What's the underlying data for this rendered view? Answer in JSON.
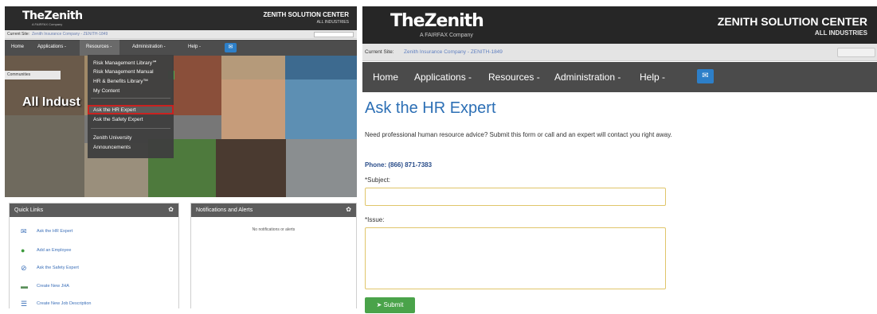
{
  "left": {
    "logo": "TheZenith",
    "logo_sub": "A FAIRFAX Company",
    "center_title": "ZENITH SOLUTION CENTER",
    "center_sub": "ALL INDUSTRIES",
    "site_label": "Current Site:",
    "site_value": "Zenith Insurance Company - ZENITH-1849",
    "nav": [
      "Home",
      "Applications -",
      "Resources -",
      "Administration -",
      "Help -"
    ],
    "tag_label": "Communities",
    "hero_text": "All Indust",
    "menu_items": [
      "Risk Management Library℠",
      "Risk Management Manual",
      "HR & Benefits Library™",
      "My Content",
      "Ask the HR Expert",
      "Ask the Safety Expert",
      "Zenith University",
      "Announcements"
    ],
    "quick_links": {
      "title": "Quick Links",
      "items": [
        {
          "label": "Ask the HR Expert",
          "icon": "mail-icon"
        },
        {
          "label": "Add an Employee",
          "icon": "person-icon"
        },
        {
          "label": "Ask the Safety Expert",
          "icon": "safety-icon"
        },
        {
          "label": "Create New JHA",
          "icon": "jha-icon"
        },
        {
          "label": "Create New Job Description",
          "icon": "list-icon"
        }
      ]
    },
    "notifications": {
      "title": "Notifications and Alerts",
      "empty_text": "No notifications or alerts"
    }
  },
  "right": {
    "logo": "TheZenith",
    "logo_sub": "A FAIRFAX Company",
    "center_title": "ZENITH SOLUTION CENTER",
    "center_sub": "ALL INDUSTRIES",
    "site_label": "Current Site:",
    "site_value": "Zenith Insurance Company - ZENITH-1849",
    "nav": [
      "Home",
      "Applications -",
      "Resources -",
      "Administration -",
      "Help -"
    ],
    "page_title": "Ask the HR Expert",
    "intro": "Need professional human resource advice? Submit this form or call and an expert will contact you right away.",
    "phone": "Phone: (866) 871-7383",
    "subject_label": "*Subject:",
    "issue_label": "*Issue:",
    "submit_label": "Submit"
  },
  "colors": {
    "header_bg": "#262626",
    "nav_bg": "#4b4b4b",
    "title_blue": "#2c6fb5",
    "submit_green": "#4aa34a",
    "field_border": "#e0c56a",
    "menu_highlight": "#cc1e1e"
  }
}
